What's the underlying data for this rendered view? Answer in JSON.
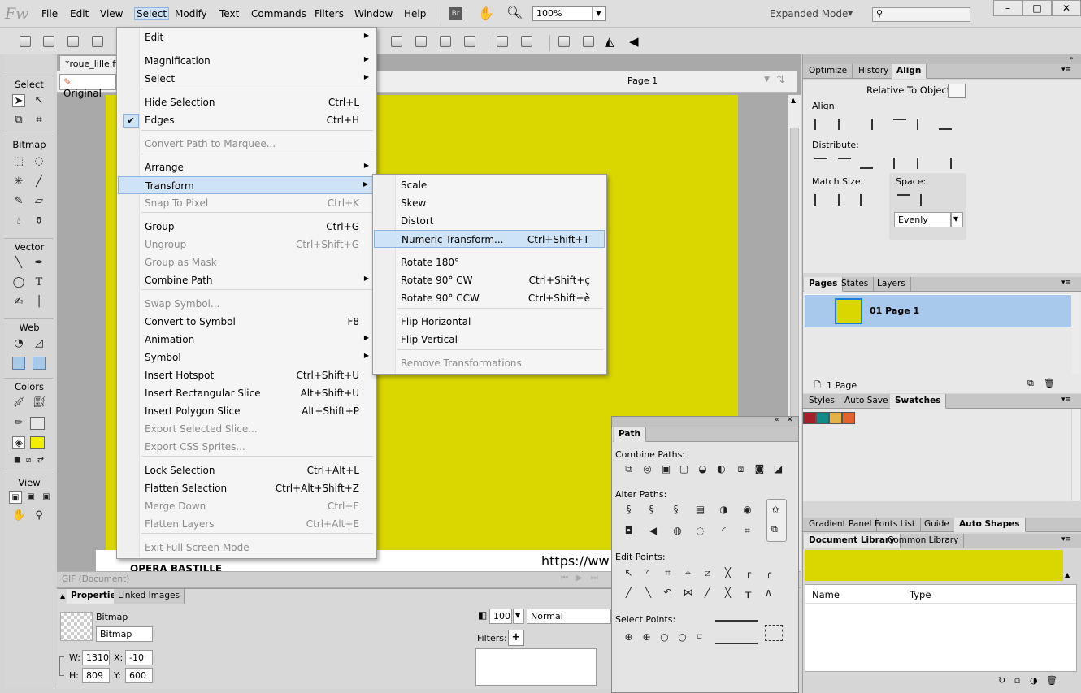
{
  "app": {
    "logo": "Fw"
  },
  "menubar": {
    "items": [
      "File",
      "Edit",
      "View",
      "Select",
      "Modify",
      "Text",
      "Commands",
      "Filters",
      "Window",
      "Help"
    ],
    "br_label": "Br",
    "zoom": "100%",
    "mode": "Expanded Mode"
  },
  "document": {
    "tab_title": "*roue_lille.fw",
    "view_button": "Original",
    "page_selector": "Page 1",
    "status": "GIF (Document)",
    "bottom_text": "https://ww",
    "bottom_left_text": "OPÉRA BASTILLE",
    "canvas_color": "#d9d600"
  },
  "tools": {
    "sections": [
      "Select",
      "Bitmap",
      "Vector",
      "Web",
      "Colors",
      "View"
    ],
    "fill_color": "#f3ef00"
  },
  "edit_menu": {
    "items": [
      {
        "label": "Edit",
        "shortcut": "",
        "submenu": true,
        "disabled": false
      },
      {
        "label": "Magnification",
        "shortcut": "",
        "submenu": true,
        "disabled": false
      },
      {
        "label": "Select",
        "shortcut": "",
        "submenu": true,
        "disabled": false
      },
      {
        "label": "Hide Selection",
        "shortcut": "Ctrl+L",
        "submenu": false,
        "disabled": false
      },
      {
        "label": "Edges",
        "shortcut": "Ctrl+H",
        "submenu": false,
        "disabled": false,
        "checked": true
      },
      {
        "label": "Convert Path to Marquee...",
        "shortcut": "",
        "submenu": false,
        "disabled": true
      },
      {
        "label": "Arrange",
        "shortcut": "",
        "submenu": true,
        "disabled": false
      },
      {
        "label": "Transform",
        "shortcut": "",
        "submenu": true,
        "disabled": false,
        "highlighted": true
      },
      {
        "label": "Snap To Pixel",
        "shortcut": "Ctrl+K",
        "submenu": false,
        "disabled": true
      },
      {
        "label": "Group",
        "shortcut": "Ctrl+G",
        "submenu": false,
        "disabled": false
      },
      {
        "label": "Ungroup",
        "shortcut": "Ctrl+Shift+G",
        "submenu": false,
        "disabled": true
      },
      {
        "label": "Group as Mask",
        "shortcut": "",
        "submenu": false,
        "disabled": true
      },
      {
        "label": "Combine Path",
        "shortcut": "",
        "submenu": true,
        "disabled": false
      },
      {
        "label": "Swap Symbol...",
        "shortcut": "",
        "submenu": false,
        "disabled": true
      },
      {
        "label": "Convert to Symbol",
        "shortcut": "F8",
        "submenu": false,
        "disabled": false
      },
      {
        "label": "Animation",
        "shortcut": "",
        "submenu": true,
        "disabled": false
      },
      {
        "label": "Symbol",
        "shortcut": "",
        "submenu": true,
        "disabled": false
      },
      {
        "label": "Insert Hotspot",
        "shortcut": "Ctrl+Shift+U",
        "submenu": false,
        "disabled": false
      },
      {
        "label": "Insert Rectangular Slice",
        "shortcut": "Alt+Shift+U",
        "submenu": false,
        "disabled": false
      },
      {
        "label": "Insert Polygon Slice",
        "shortcut": "Alt+Shift+P",
        "submenu": false,
        "disabled": false
      },
      {
        "label": "Export Selected Slice...",
        "shortcut": "",
        "submenu": false,
        "disabled": true
      },
      {
        "label": "Export CSS Sprites...",
        "shortcut": "",
        "submenu": false,
        "disabled": true
      },
      {
        "label": "Lock Selection",
        "shortcut": "Ctrl+Alt+L",
        "submenu": false,
        "disabled": false
      },
      {
        "label": "Flatten Selection",
        "shortcut": "Ctrl+Alt+Shift+Z",
        "submenu": false,
        "disabled": false
      },
      {
        "label": "Merge Down",
        "shortcut": "Ctrl+E",
        "submenu": false,
        "disabled": true
      },
      {
        "label": "Flatten Layers",
        "shortcut": "Ctrl+Alt+E",
        "submenu": false,
        "disabled": true
      },
      {
        "label": "Exit Full Screen Mode",
        "shortcut": "",
        "submenu": false,
        "disabled": true
      }
    ]
  },
  "transform_menu": {
    "items": [
      {
        "label": "Scale",
        "shortcut": "",
        "disabled": false
      },
      {
        "label": "Skew",
        "shortcut": "",
        "disabled": false
      },
      {
        "label": "Distort",
        "shortcut": "",
        "disabled": false
      },
      {
        "label": "Numeric Transform...",
        "shortcut": "Ctrl+Shift+T",
        "disabled": false,
        "highlighted": true
      },
      {
        "label": "Rotate 180°",
        "shortcut": "",
        "disabled": false
      },
      {
        "label": "Rotate 90° CW",
        "shortcut": "Ctrl+Shift+ç",
        "disabled": false
      },
      {
        "label": "Rotate 90° CCW",
        "shortcut": "Ctrl+Shift+è",
        "disabled": false
      },
      {
        "label": "Flip Horizontal",
        "shortcut": "",
        "disabled": false
      },
      {
        "label": "Flip Vertical",
        "shortcut": "",
        "disabled": false
      },
      {
        "label": "Remove Transformations",
        "shortcut": "",
        "disabled": true
      }
    ]
  },
  "properties": {
    "tabs": [
      "Properties",
      "Linked Images"
    ],
    "object_type": "Bitmap",
    "name_field": "Bitmap",
    "w_label": "W:",
    "w": "1310",
    "x_label": "X:",
    "x": "-10",
    "h_label": "H:",
    "h": "809",
    "y_label": "Y:",
    "y": "600",
    "opacity": "100",
    "blend": "Normal",
    "filters_label": "Filters:"
  },
  "align_panel": {
    "tabs": [
      "Optimize",
      "History",
      "Align"
    ],
    "relative": "Relative To Object",
    "align_label": "Align:",
    "distribute_label": "Distribute:",
    "match_label": "Match Size:",
    "space_label": "Space:",
    "space_value": "Evenly"
  },
  "pages_panel": {
    "tabs": [
      "Pages",
      "States",
      "Layers"
    ],
    "page_name": "01  Page 1",
    "count": "1 Page"
  },
  "swatches_panel": {
    "tabs": [
      "Styles",
      "Auto Save",
      "Swatches"
    ],
    "colors": [
      "#a3202a",
      "#138a8a",
      "#e5b24a",
      "#e4622d"
    ]
  },
  "library_panel": {
    "tabs1": [
      "Gradient Panel",
      "Fonts List",
      "Guide",
      "Auto Shapes"
    ],
    "tabs2": [
      "Document Library",
      "Common Library"
    ],
    "col_name": "Name",
    "col_type": "Type"
  },
  "path_panel": {
    "title": "Path",
    "combine": "Combine Paths:",
    "alter": "Alter Paths:",
    "edit": "Edit Points:",
    "select": "Select Points:"
  }
}
